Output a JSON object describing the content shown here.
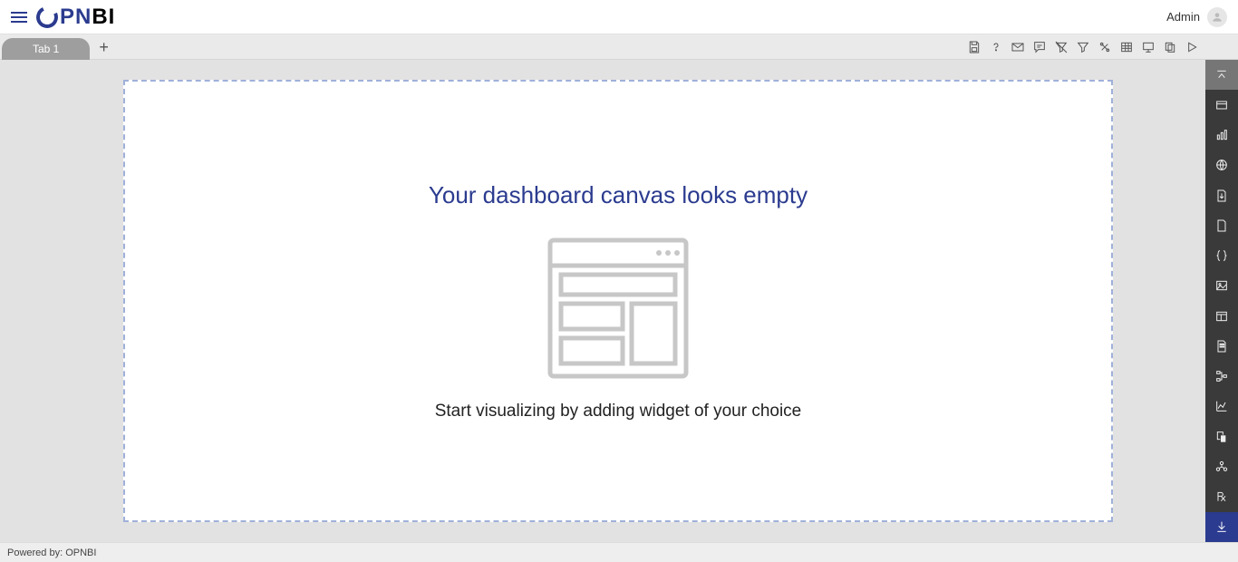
{
  "header": {
    "logo_text_1": "PN",
    "logo_text_2": "BI",
    "user_label": "Admin"
  },
  "tabs": {
    "active": "Tab 1"
  },
  "canvas": {
    "title": "Your dashboard canvas looks empty",
    "subtitle": "Start visualizing by adding widget of your choice"
  },
  "footer": {
    "text": "Powered by: OPNBI"
  },
  "toolbar_icons": [
    "save-icon",
    "help-icon",
    "mail-icon",
    "comment-icon",
    "clear-filter-icon",
    "filter-icon",
    "settings-icon",
    "table-icon",
    "presentation-icon",
    "copy-icon",
    "play-icon"
  ],
  "rail_icons": [
    "collapse-up-icon",
    "card-icon",
    "chart-icon",
    "geo-icon",
    "file-download-icon",
    "doc-icon",
    "json-icon",
    "image-icon",
    "container-icon",
    "note-icon",
    "tree-icon",
    "line-chart-icon",
    "duplicate-icon",
    "cluster-icon",
    "rx-icon",
    "download-icon"
  ]
}
